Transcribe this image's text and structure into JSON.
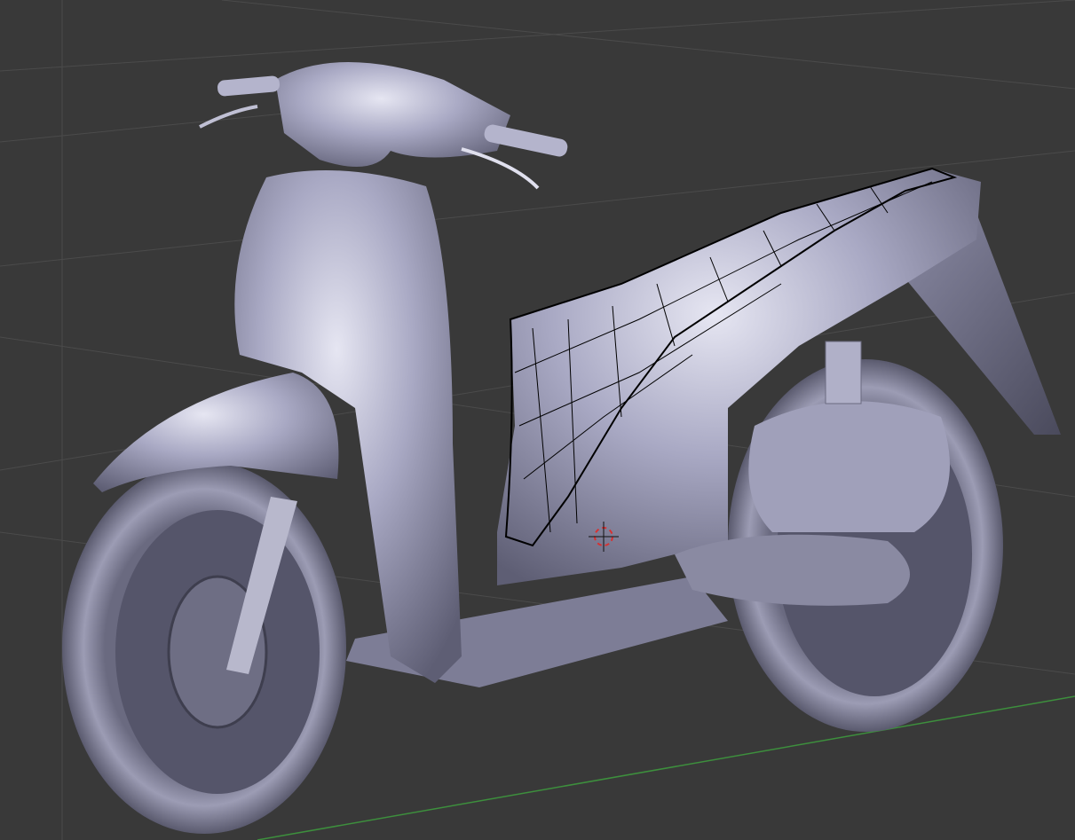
{
  "viewport": {
    "background": "#393939",
    "grid_color": "#4b4b4b",
    "x_axis_color": "#3d8f3d",
    "model_color": "#a9a9c4",
    "wire_color": "#000000",
    "cursor_color": "#d83030"
  }
}
